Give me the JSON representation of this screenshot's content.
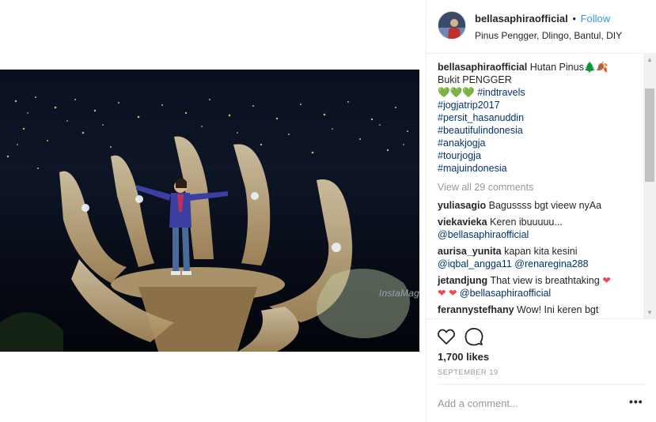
{
  "post": {
    "username": "bellasaphiraofficial",
    "dot": "•",
    "follow_label": "Follow",
    "location": "Pinus Pengger, Dlingo, Bantul, DIY",
    "watermark": "InstaMag"
  },
  "caption": {
    "username": "bellasaphiraofficial",
    "line1": "Hutan Pinus",
    "emoji_tree": "🌲",
    "emoji_leaf": "🍂",
    "line2": "Bukit PENGGER",
    "hearts": "💚💚💚",
    "hashtags": [
      "#indtravels",
      "#jogjatrip2017",
      "#persit_hasanuddin",
      "#beautifulindonesia",
      "#anakjogja",
      "#tourjogja",
      "#majuindonesia"
    ]
  },
  "view_all_comments": "View all 29 comments",
  "comments": [
    {
      "user": "yuliasagio",
      "text": "Bagussss bgt vieew nyAa"
    },
    {
      "user": "viekavieka",
      "text": "Keren ibuuuuu...",
      "mention": "@bellasaphiraofficial"
    },
    {
      "user": "aurisa_yunita",
      "text": "kapan kita kesini",
      "mention": "@iqbal_angga11",
      "mention2": "@renaregina288"
    },
    {
      "user": "jetandjung",
      "text": "That view is breathtaking",
      "hearts": "❤",
      "hearts2": "❤ ❤",
      "mention": "@bellasaphiraofficial"
    },
    {
      "user": "ferannystefhany",
      "text": "Wow! Ini keren bgt"
    }
  ],
  "actions": {
    "like_icon": "heart-outline-icon",
    "comment_icon": "comment-bubble-icon",
    "likes": "1,700 likes",
    "date": "SEPTEMBER 19",
    "add_comment_placeholder": "Add a comment...",
    "more_label": "•••"
  },
  "colors": {
    "link": "#003569",
    "follow": "#3897f0",
    "muted": "#999999",
    "heart": "#ed4956"
  }
}
